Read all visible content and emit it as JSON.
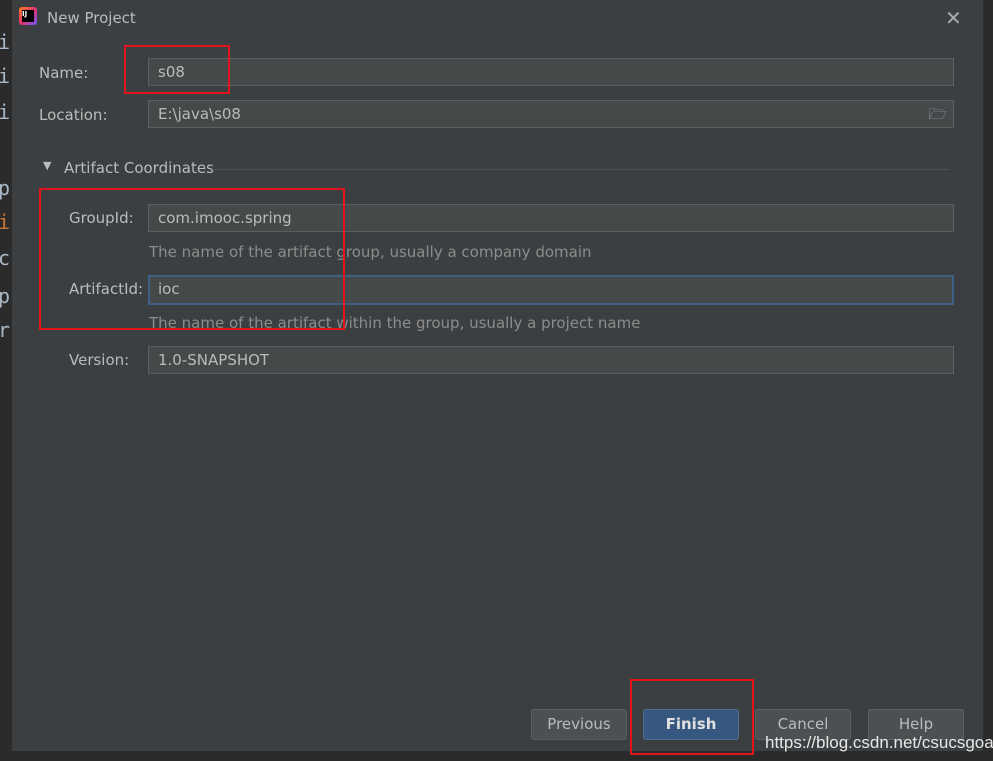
{
  "window": {
    "title": "New Project",
    "close_icon": "close-icon"
  },
  "editor_chars": [
    "i",
    "i",
    "i",
    "p",
    "i",
    "c",
    "p",
    "r"
  ],
  "form": {
    "name": {
      "label": "Name:",
      "value": "s08"
    },
    "location": {
      "label": "Location:",
      "value": "E:\\java\\s08"
    },
    "section": {
      "label": "Artifact Coordinates"
    },
    "group_id": {
      "label": "GroupId:",
      "value": "com.imooc.spring",
      "hint": "The name of the artifact group, usually a company domain"
    },
    "artifact_id": {
      "label": "ArtifactId:",
      "value": "ioc",
      "hint": "The name of the artifact within the group, usually a project name"
    },
    "version": {
      "label": "Version:",
      "value": "1.0-SNAPSHOT"
    }
  },
  "buttons": {
    "previous": "Previous",
    "finish": "Finish",
    "cancel": "Cancel",
    "help": "Help"
  },
  "watermark": "https://blog.csdn.net/csucsgoat",
  "colors": {
    "highlight": "#e0161c",
    "accent": "#365880"
  }
}
